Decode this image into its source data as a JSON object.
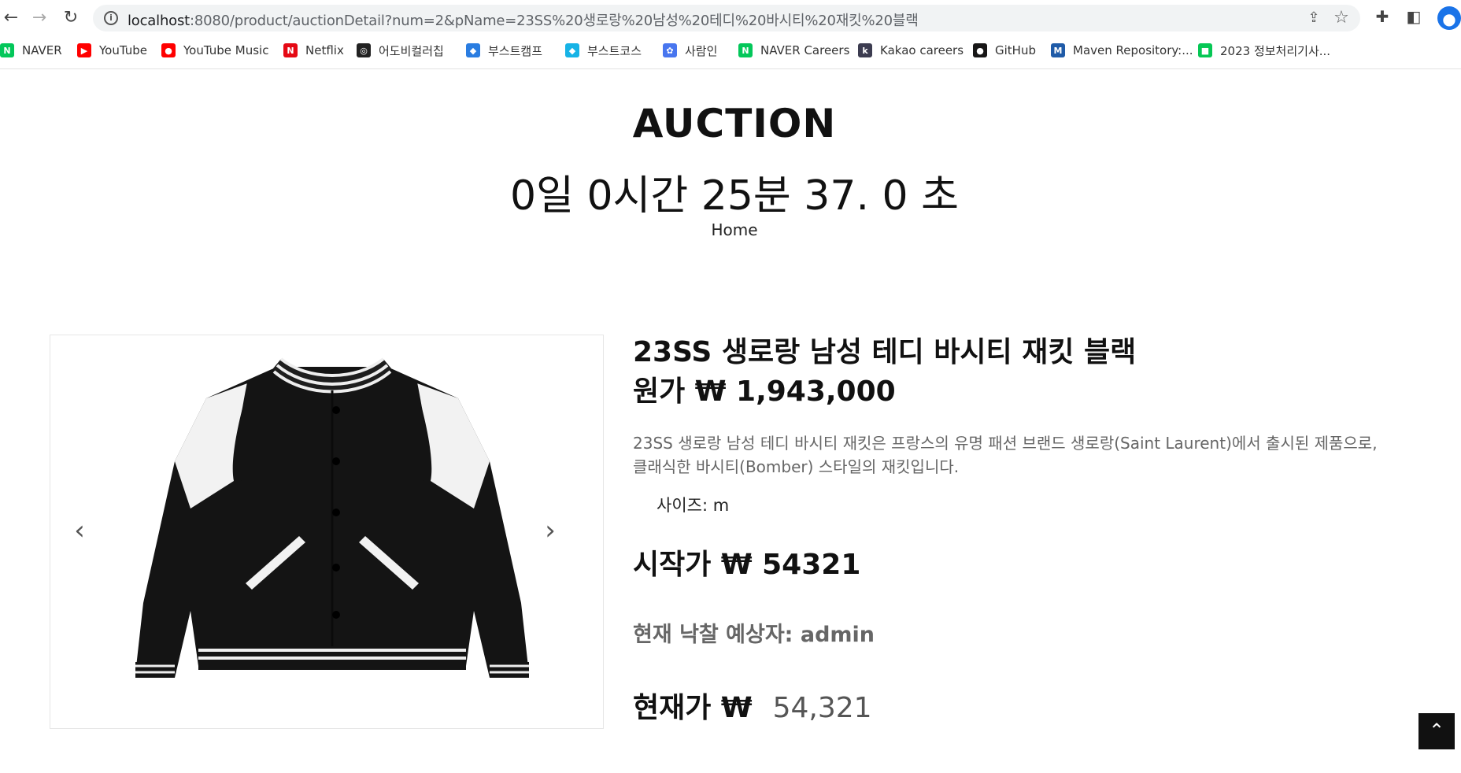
{
  "browser": {
    "url_host": "localhost",
    "url_path": ":8080/product/auctionDetail?num=2&pName=23SS%20생로랑%20남성%20테디%20바시티%20재킷%20블랙",
    "bookmarks": [
      {
        "label": "NAVER",
        "icon": "naver-icon",
        "color": "#03c75a",
        "glyph": "N"
      },
      {
        "label": "YouTube",
        "icon": "youtube-icon",
        "color": "#ff0000",
        "glyph": "▶"
      },
      {
        "label": "YouTube Music",
        "icon": "youtube-music-icon",
        "color": "#ff0000",
        "glyph": "●"
      },
      {
        "label": "Netflix",
        "icon": "netflix-icon",
        "color": "#e50914",
        "glyph": "N"
      },
      {
        "label": "어도비컬러칩",
        "icon": "adobe-color-icon",
        "color": "#222222",
        "glyph": "◎"
      },
      {
        "label": "부스트캠프",
        "icon": "boostcamp-icon",
        "color": "#2a7de1",
        "glyph": "◆"
      },
      {
        "label": "부스트코스",
        "icon": "boostcourse-icon",
        "color": "#16b3e6",
        "glyph": "◆"
      },
      {
        "label": "사람인",
        "icon": "saramin-icon",
        "color": "#4876ef",
        "glyph": "✿"
      },
      {
        "label": "NAVER Careers",
        "icon": "naver-careers-icon",
        "color": "#03c75a",
        "glyph": "N"
      },
      {
        "label": "Kakao careers",
        "icon": "kakao-careers-icon",
        "color": "#3c3c50",
        "glyph": "k"
      },
      {
        "label": "GitHub",
        "icon": "github-icon",
        "color": "#181717",
        "glyph": "●"
      },
      {
        "label": "Maven Repository:...",
        "icon": "maven-icon",
        "color": "#1f5ba8",
        "glyph": "M"
      },
      {
        "label": "2023 정보처리기사...",
        "icon": "line-icon",
        "color": "#06c755",
        "glyph": "■"
      }
    ]
  },
  "header": {
    "title": "AUCTION",
    "countdown": "0일 0시간 25분 37. 0 초",
    "breadcrumb": "Home"
  },
  "product": {
    "name": "23SS 생로랑 남성 테디 바시티 재킷 블랙",
    "original_price": "원가 ₩ 1,943,000",
    "description_line1": "23SS 생로랑 남성 테디 바시티 재킷은 프랑스의 유명 패션 브랜드 생로랑(Saint Laurent)에서 출시된 제품으로,",
    "description_line2": "클래식한 바시티(Bomber) 스타일의 재킷입니다.",
    "size": "사이즈: m",
    "start_price": "시작가 ₩ 54321",
    "expected_winner": "현재 낙찰 예상자: admin",
    "current_price_label": "현재가 ₩",
    "current_price_value": "54,321"
  },
  "carousel": {
    "prev": "‹",
    "next": "›"
  },
  "totop_label": "⌃"
}
